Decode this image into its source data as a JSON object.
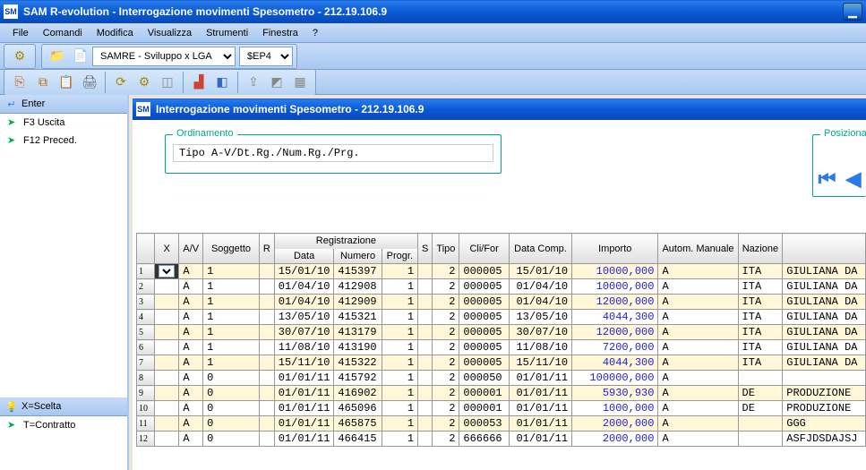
{
  "title": "SAM R-evolution  -  Interrogazione movimenti  Spesometro     -    212.19.106.9",
  "menu": [
    "File",
    "Comandi",
    "Modifica",
    "Visualizza",
    "Strumenti",
    "Finestra",
    "?"
  ],
  "combo1": "SAMRE - Sviluppo x LGA",
  "combo2": "$EP4",
  "side": {
    "enter": "Enter",
    "f3": "F3  Uscita",
    "f12": "F12 Preced.",
    "xs": "X=Scelta",
    "tc": "T=Contratto"
  },
  "mdi_title": "Interrogazione movimenti  Spesometro     -    212.19.106.9",
  "ordbox": {
    "legend": "Ordinamento",
    "value": "Tipo A-V/Dt.Rg./Num.Rg./Prg."
  },
  "posbox": {
    "legend": "Posizioname"
  },
  "cols": {
    "x": "X",
    "av": "A/V",
    "sog": "Soggetto",
    "r": "R",
    "reg": "Registrazione",
    "data": "Data",
    "num": "Numero",
    "prg": "Progr.",
    "s": "S",
    "tipo": "Tipo",
    "cf": "Cli/For",
    "dc": "Data Comp.",
    "imp": "Importo",
    "am": "Autom. Manuale",
    "naz": "Nazione"
  },
  "rows": [
    {
      "n": "1",
      "av": "A",
      "sog": "1",
      "data": "15/01/10",
      "num": "415397",
      "prg": "1",
      "tipo": "2",
      "cf": "000005",
      "dc": "15/01/10",
      "imp": "10000,000",
      "am": "A",
      "naz": "ITA",
      "desc": "GIULIANA  DA"
    },
    {
      "n": "2",
      "av": "A",
      "sog": "1",
      "data": "01/04/10",
      "num": "412908",
      "prg": "1",
      "tipo": "2",
      "cf": "000005",
      "dc": "01/04/10",
      "imp": "10000,000",
      "am": "A",
      "naz": "ITA",
      "desc": "GIULIANA  DA"
    },
    {
      "n": "3",
      "av": "A",
      "sog": "1",
      "data": "01/04/10",
      "num": "412909",
      "prg": "1",
      "tipo": "2",
      "cf": "000005",
      "dc": "01/04/10",
      "imp": "12000,000",
      "am": "A",
      "naz": "ITA",
      "desc": "GIULIANA  DA"
    },
    {
      "n": "4",
      "av": "A",
      "sog": "1",
      "data": "13/05/10",
      "num": "415321",
      "prg": "1",
      "tipo": "2",
      "cf": "000005",
      "dc": "13/05/10",
      "imp": "4044,300",
      "am": "A",
      "naz": "ITA",
      "desc": "GIULIANA  DA"
    },
    {
      "n": "5",
      "av": "A",
      "sog": "1",
      "data": "30/07/10",
      "num": "413179",
      "prg": "1",
      "tipo": "2",
      "cf": "000005",
      "dc": "30/07/10",
      "imp": "12000,000",
      "am": "A",
      "naz": "ITA",
      "desc": "GIULIANA  DA"
    },
    {
      "n": "6",
      "av": "A",
      "sog": "1",
      "data": "11/08/10",
      "num": "413190",
      "prg": "1",
      "tipo": "2",
      "cf": "000005",
      "dc": "11/08/10",
      "imp": "7200,000",
      "am": "A",
      "naz": "ITA",
      "desc": "GIULIANA  DA"
    },
    {
      "n": "7",
      "av": "A",
      "sog": "1",
      "data": "15/11/10",
      "num": "415322",
      "prg": "1",
      "tipo": "2",
      "cf": "000005",
      "dc": "15/11/10",
      "imp": "4044,300",
      "am": "A",
      "naz": "ITA",
      "desc": "GIULIANA  DA"
    },
    {
      "n": "8",
      "av": "A",
      "sog": "0",
      "data": "01/01/11",
      "num": "415792",
      "prg": "1",
      "tipo": "2",
      "cf": "000050",
      "dc": "01/01/11",
      "imp": "100000,000",
      "am": "A",
      "naz": "",
      "desc": ""
    },
    {
      "n": "9",
      "av": "A",
      "sog": "0",
      "data": "01/01/11",
      "num": "416902",
      "prg": "1",
      "tipo": "2",
      "cf": "000001",
      "dc": "01/01/11",
      "imp": "5930,930",
      "am": "A",
      "naz": "DE",
      "desc": "PRODUZIONE"
    },
    {
      "n": "10",
      "av": "A",
      "sog": "0",
      "data": "01/01/11",
      "num": "465096",
      "prg": "1",
      "tipo": "2",
      "cf": "000001",
      "dc": "01/01/11",
      "imp": "1000,000",
      "am": "A",
      "naz": "DE",
      "desc": "PRODUZIONE"
    },
    {
      "n": "11",
      "av": "A",
      "sog": "0",
      "data": "01/01/11",
      "num": "465875",
      "prg": "1",
      "tipo": "2",
      "cf": "000053",
      "dc": "01/01/11",
      "imp": "2000,000",
      "am": "A",
      "naz": "",
      "desc": "GGG"
    },
    {
      "n": "12",
      "av": "A",
      "sog": "0",
      "data": "01/01/11",
      "num": "466415",
      "prg": "1",
      "tipo": "2",
      "cf": "666666",
      "dc": "01/01/11",
      "imp": "2000,000",
      "am": "A",
      "naz": "",
      "desc": "ASFJDSDAJSJ"
    }
  ]
}
